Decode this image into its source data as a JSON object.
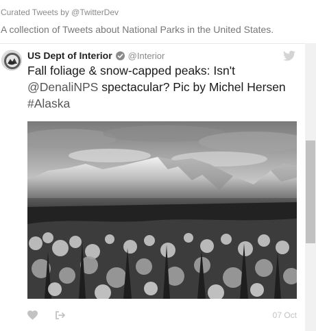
{
  "header": {
    "curated_by": "Curated Tweets by @TwitterDev",
    "description": "A collection of Tweets about National Parks in the United States."
  },
  "tweet": {
    "author_name": "US Dept of Interior",
    "handle": "@Interior",
    "verified": true,
    "text_before_mention": "Fall foliage & snow-capped peaks: Isn't ",
    "mention": "@DenaliNPS",
    "text_after_mention": " spectacular? Pic by Michel Hersen ",
    "hashtag": "#Alaska",
    "date": "07 Oct"
  },
  "icons": {
    "avatar": "interior-seal-icon",
    "verified": "verified-badge-icon",
    "logo": "twitter-bird-icon",
    "like": "heart-icon",
    "share": "share-icon"
  },
  "colors": {
    "text": "#1a1a1a",
    "muted": "#8a8a8a",
    "divider": "#e8e8e8"
  }
}
